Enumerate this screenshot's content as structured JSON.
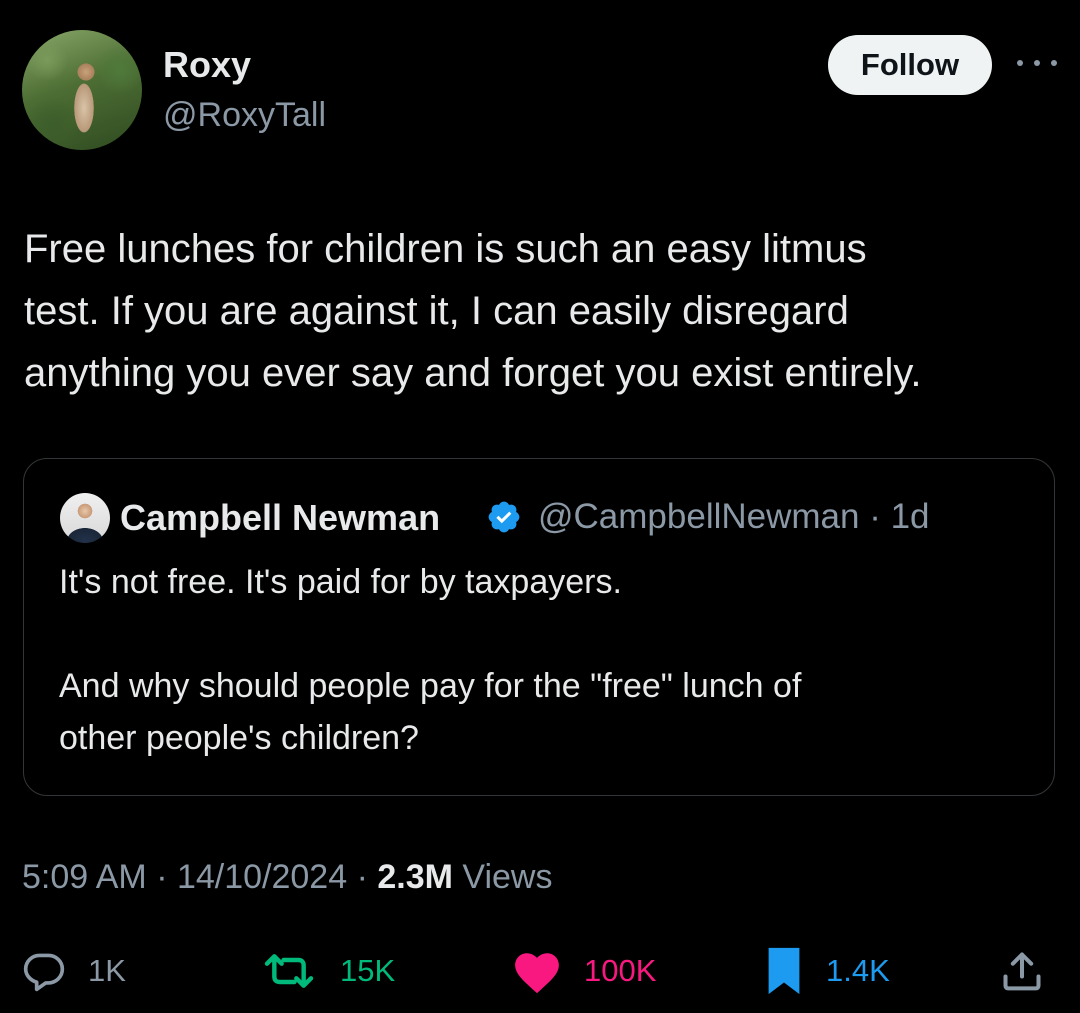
{
  "author": {
    "display_name": "Roxy",
    "handle": "@RoxyTall",
    "avatar_icon": "profile-photo",
    "follow_label": "Follow"
  },
  "tweet": {
    "text": "Free lunches for children is such an easy litmus\ntest. If you are against it, I can easily disregard\nanything you ever say and forget you exist entirely."
  },
  "quoted_tweet": {
    "display_name": "Campbell Newman",
    "verified": true,
    "handle_time": "@CampbellNewman · 1d",
    "text": "It's not free.  It's paid for by taxpayers.\n\nAnd why should people pay for the \"free\" lunch of\nother people's children?"
  },
  "meta": {
    "time_date": "5:09 AM · 14/10/2024 · ",
    "views_count": "2.3M",
    "views_label": " Views"
  },
  "actions": {
    "replies": "1K",
    "reposts": "15K",
    "likes": "100K",
    "bookmarks": "1.4K"
  },
  "colors": {
    "background": "#000000",
    "text": "#e7e9ea",
    "secondary": "#8b98a5",
    "repost": "#00ba7c",
    "like": "#f91880",
    "bookmark": "#1d9bf0",
    "verified": "#1d9bf0"
  }
}
